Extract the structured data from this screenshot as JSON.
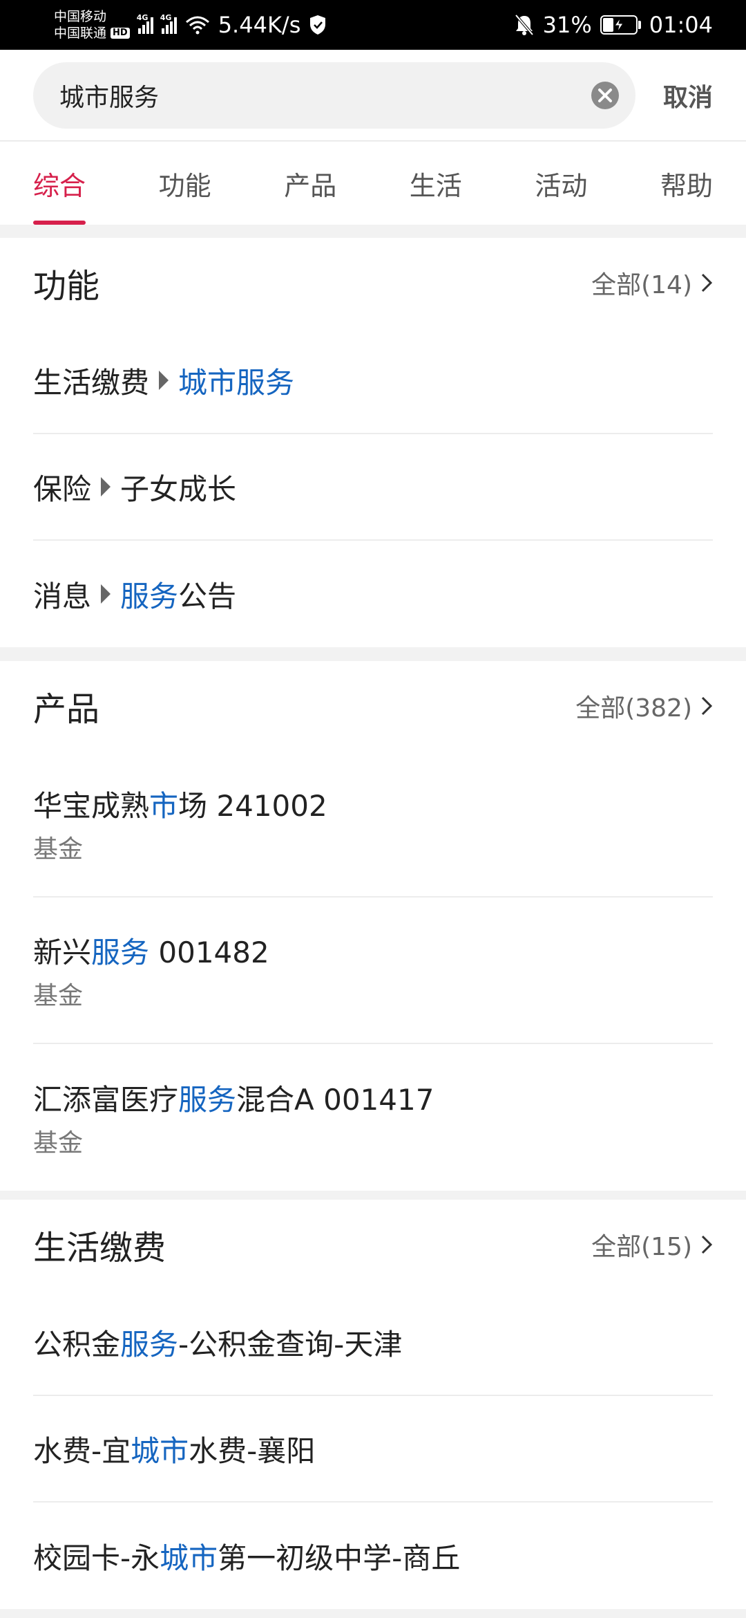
{
  "status_bar": {
    "carrier1": "中国移动",
    "carrier2": "中国联通",
    "hd": "HD",
    "net1": "4G",
    "net2": "4G",
    "speed": "5.44K/s",
    "battery": "31%",
    "time": "01:04"
  },
  "search": {
    "value": "城市服务",
    "cancel_label": "取消"
  },
  "tabs": [
    "综合",
    "功能",
    "产品",
    "生活",
    "活动",
    "帮助"
  ],
  "sections": {
    "functions": {
      "title": "功能",
      "more": "全部(14)",
      "items": [
        {
          "parent": "生活缴费",
          "child_hl": "城市服务",
          "child_rest": ""
        },
        {
          "parent": "保险",
          "child_hl": "",
          "child_rest": "子女成长"
        },
        {
          "parent": "消息",
          "child_hl": "服务",
          "child_rest": "公告"
        }
      ]
    },
    "products": {
      "title": "产品",
      "more": "全部(382)",
      "items": [
        {
          "pre": "华宝成熟",
          "hl": "市",
          "post": "场 241002",
          "sub": "基金"
        },
        {
          "pre": "新兴",
          "hl": "服务",
          "post": " 001482",
          "sub": "基金"
        },
        {
          "pre": "汇添富医疗",
          "hl": "服务",
          "post": "混合A 001417",
          "sub": "基金"
        }
      ]
    },
    "life": {
      "title": "生活缴费",
      "more": "全部(15)",
      "items": [
        {
          "pre": "公积金",
          "hl": "服务",
          "post": "-公积金查询-天津"
        },
        {
          "pre": "水费-宜",
          "hl": "城市",
          "post": "水费-襄阳"
        },
        {
          "pre": "校园卡-永",
          "hl": "城市",
          "post": "第一初级中学-商丘"
        }
      ]
    }
  },
  "colors": {
    "accent": "#d6204b",
    "highlight": "#1565c0"
  }
}
